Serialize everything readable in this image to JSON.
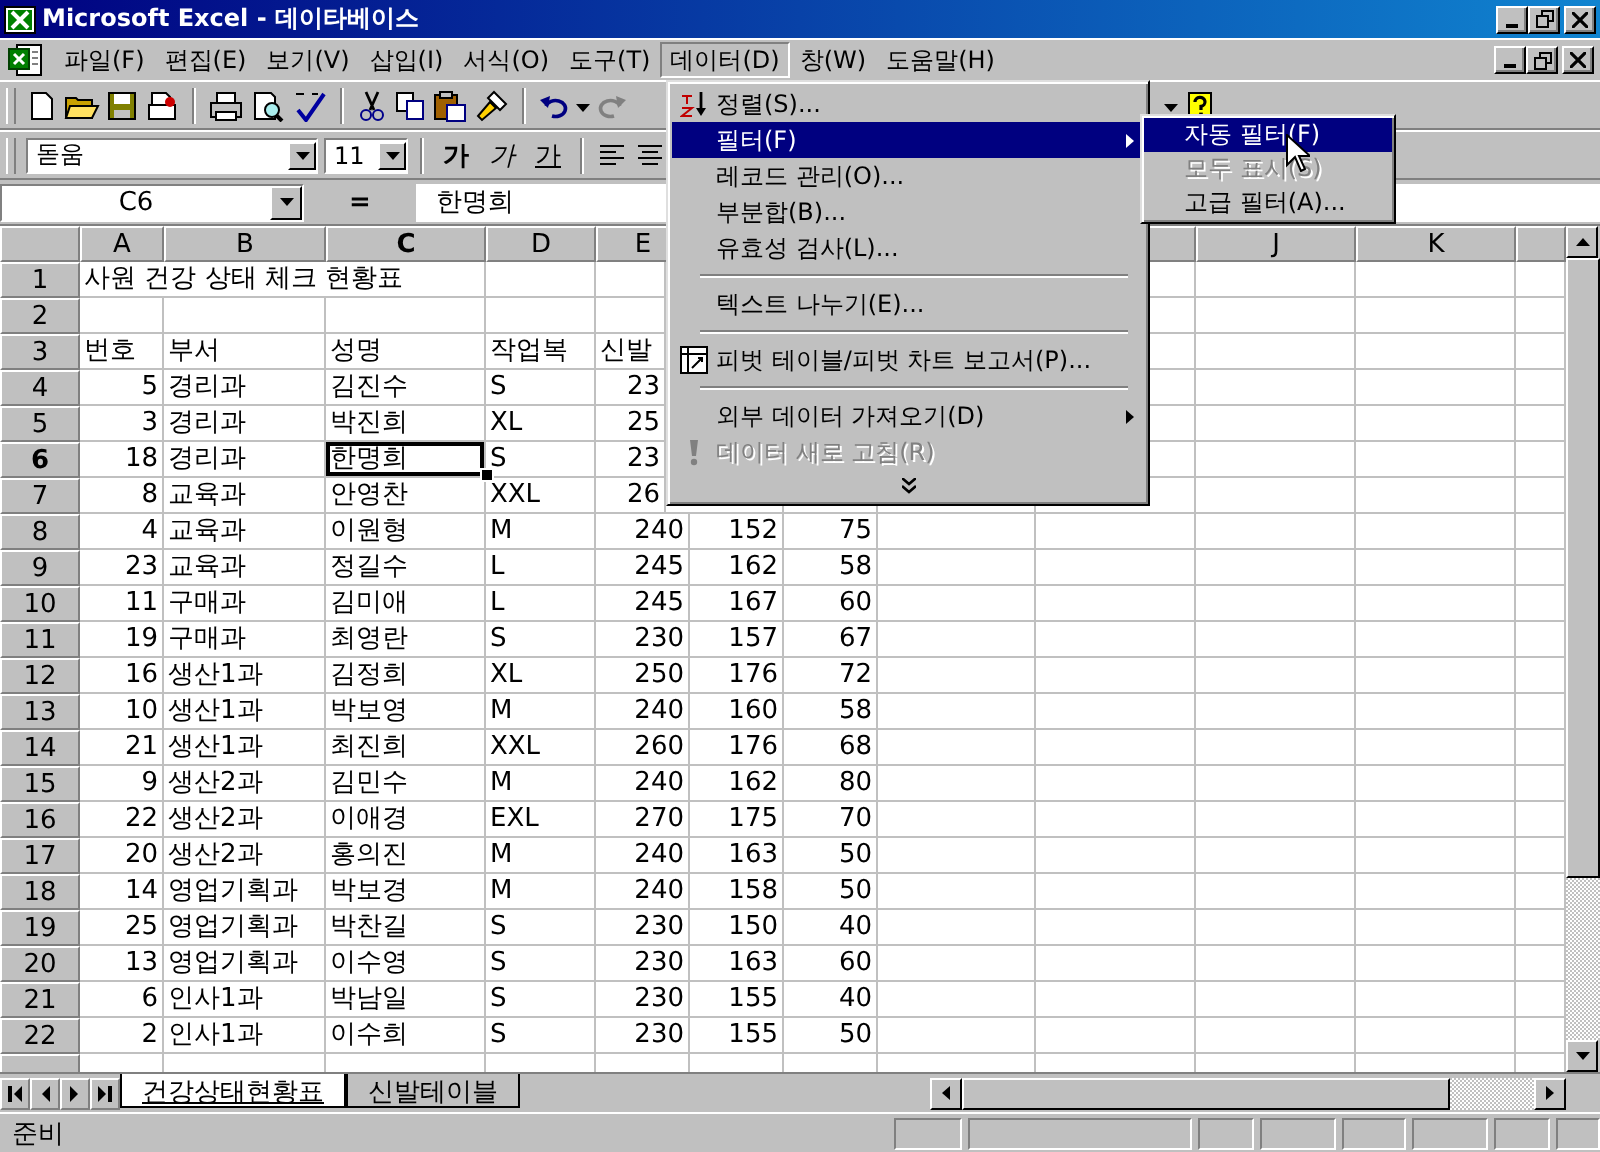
{
  "window": {
    "title": "Microsoft Excel - 데이타베이스"
  },
  "menu_bar": [
    {
      "label": "파일(F)",
      "selected": false
    },
    {
      "label": "편집(E)",
      "selected": false
    },
    {
      "label": "보기(V)",
      "selected": false
    },
    {
      "label": "삽입(I)",
      "selected": false
    },
    {
      "label": "서식(O)",
      "selected": false
    },
    {
      "label": "도구(T)",
      "selected": false
    },
    {
      "label": "데이터(D)",
      "selected": true
    },
    {
      "label": "창(W)",
      "selected": false
    },
    {
      "label": "도움말(H)",
      "selected": false
    }
  ],
  "format_toolbar": {
    "font": "돋움",
    "size": "11",
    "style_buttons": [
      {
        "label": "가",
        "kind": "bold"
      },
      {
        "label": "가",
        "kind": "italic"
      },
      {
        "label": "가",
        "kind": "underline"
      }
    ]
  },
  "formula_bar": {
    "name_box": "C6",
    "equals": "=",
    "value": "한명희"
  },
  "columns": [
    {
      "label": "A",
      "selected": false
    },
    {
      "label": "B",
      "selected": false
    },
    {
      "label": "C",
      "selected": true
    },
    {
      "label": "D",
      "selected": false
    },
    {
      "label": "E",
      "selected": false
    },
    {
      "label": "J",
      "selected": false
    },
    {
      "label": "K",
      "selected": false
    }
  ],
  "rows": [
    {
      "number": "1",
      "selected": false,
      "kind": "title",
      "cells": [
        "사원 건강 상태 체크 현황표"
      ]
    },
    {
      "number": "2",
      "selected": false,
      "kind": "title",
      "cells": []
    },
    {
      "number": "3",
      "selected": false,
      "kind": "header",
      "cells": [
        "번호",
        "부서",
        "성명",
        "작업복",
        "신발"
      ]
    },
    {
      "number": "4",
      "selected": false,
      "kind": "record",
      "cells": [
        "5",
        "경리과",
        "김진수",
        "S",
        "23"
      ]
    },
    {
      "number": "5",
      "selected": false,
      "kind": "record",
      "cells": [
        "3",
        "경리과",
        "박진희",
        "XL",
        "25"
      ]
    },
    {
      "number": "6",
      "selected": true,
      "kind": "record",
      "cells": [
        "18",
        "경리과",
        "한명희",
        "S",
        "23"
      ]
    },
    {
      "number": "7",
      "selected": false,
      "kind": "record",
      "cells": [
        "8",
        "교육과",
        "안영찬",
        "XXL",
        "26"
      ]
    },
    {
      "number": "8",
      "selected": false,
      "kind": "record",
      "cells": [
        "4",
        "교육과",
        "이원형",
        "M",
        "240",
        "152",
        "75"
      ]
    },
    {
      "number": "9",
      "selected": false,
      "kind": "record",
      "cells": [
        "23",
        "교육과",
        "정길수",
        "L",
        "245",
        "162",
        "58"
      ]
    },
    {
      "number": "10",
      "selected": false,
      "kind": "record",
      "cells": [
        "11",
        "구매과",
        "김미애",
        "L",
        "245",
        "167",
        "60"
      ]
    },
    {
      "number": "11",
      "selected": false,
      "kind": "record",
      "cells": [
        "19",
        "구매과",
        "최영란",
        "S",
        "230",
        "157",
        "67"
      ]
    },
    {
      "number": "12",
      "selected": false,
      "kind": "record",
      "cells": [
        "16",
        "생산1과",
        "김정희",
        "XL",
        "250",
        "176",
        "72"
      ]
    },
    {
      "number": "13",
      "selected": false,
      "kind": "record",
      "cells": [
        "10",
        "생산1과",
        "박보영",
        "M",
        "240",
        "160",
        "58"
      ]
    },
    {
      "number": "14",
      "selected": false,
      "kind": "record",
      "cells": [
        "21",
        "생산1과",
        "최진희",
        "XXL",
        "260",
        "176",
        "68"
      ]
    },
    {
      "number": "15",
      "selected": false,
      "kind": "record",
      "cells": [
        "9",
        "생산2과",
        "김민수",
        "M",
        "240",
        "162",
        "80"
      ]
    },
    {
      "number": "16",
      "selected": false,
      "kind": "record",
      "cells": [
        "22",
        "생산2과",
        "이애경",
        "EXL",
        "270",
        "175",
        "70"
      ]
    },
    {
      "number": "17",
      "selected": false,
      "kind": "record",
      "cells": [
        "20",
        "생산2과",
        "홍의진",
        "M",
        "240",
        "163",
        "50"
      ]
    },
    {
      "number": "18",
      "selected": false,
      "kind": "record",
      "cells": [
        "14",
        "영업기획과",
        "박보경",
        "M",
        "240",
        "158",
        "50"
      ]
    },
    {
      "number": "19",
      "selected": false,
      "kind": "record",
      "cells": [
        "25",
        "영업기획과",
        "박찬길",
        "S",
        "230",
        "150",
        "40"
      ]
    },
    {
      "number": "20",
      "selected": false,
      "kind": "record",
      "cells": [
        "13",
        "영업기획과",
        "이수영",
        "S",
        "230",
        "163",
        "60"
      ]
    },
    {
      "number": "21",
      "selected": false,
      "kind": "record",
      "cells": [
        "6",
        "인사1과",
        "박남일",
        "S",
        "230",
        "155",
        "40"
      ]
    },
    {
      "number": "22",
      "selected": false,
      "kind": "record",
      "cells": [
        "2",
        "인사1과",
        "이수희",
        "S",
        "230",
        "155",
        "50"
      ]
    }
  ],
  "data_menu": [
    {
      "kind": "sort",
      "label": "정렬(S)...",
      "highlighted": false,
      "disabled": false,
      "submenu": false
    },
    {
      "kind": "command",
      "label": "필터(F)",
      "highlighted": true,
      "disabled": false,
      "submenu": true
    },
    {
      "kind": "command",
      "label": "레코드 관리(O)...",
      "highlighted": false,
      "disabled": false,
      "submenu": false
    },
    {
      "kind": "command",
      "label": "부분합(B)...",
      "highlighted": false,
      "disabled": false,
      "submenu": false
    },
    {
      "kind": "command",
      "label": "유효성 검사(L)...",
      "highlighted": false,
      "disabled": false,
      "submenu": false
    },
    {
      "kind": "separator"
    },
    {
      "kind": "command",
      "label": "텍스트 나누기(E)...",
      "highlighted": false,
      "disabled": false,
      "submenu": false
    },
    {
      "kind": "separator"
    },
    {
      "kind": "pivot",
      "label": "피벗 테이블/피벗 차트 보고서(P)...",
      "highlighted": false,
      "disabled": false,
      "submenu": false
    },
    {
      "kind": "separator"
    },
    {
      "kind": "command",
      "label": "외부 데이터 가져오기(D)",
      "highlighted": false,
      "disabled": false,
      "submenu": true
    },
    {
      "kind": "refresh",
      "label": "데이터 새로 고침(R)",
      "highlighted": false,
      "disabled": true,
      "submenu": false
    },
    {
      "kind": "expand"
    }
  ],
  "filter_submenu": [
    {
      "label": "자동 필터(F)",
      "highlighted": true,
      "disabled": false
    },
    {
      "label": "모두 표시(S)",
      "highlighted": false,
      "disabled": true
    },
    {
      "label": "고급 필터(A)...",
      "highlighted": false,
      "disabled": false
    }
  ],
  "sheet_tabs": [
    {
      "label": "건강상태현황표",
      "selected": true
    },
    {
      "label": "신발테이블",
      "selected": false
    }
  ],
  "status_bar": {
    "text": "준비"
  }
}
